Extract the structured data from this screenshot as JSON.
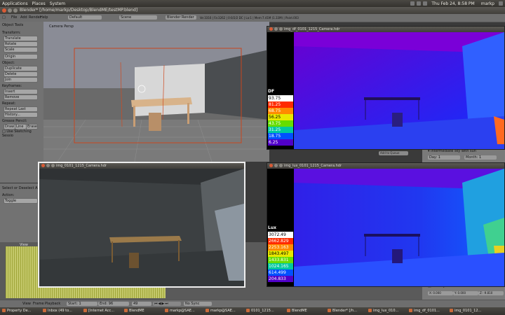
{
  "gnome_panel": {
    "menus": [
      "Applications",
      "Places",
      "System"
    ],
    "datetime": "Thu Feb 24, 8:58 PM",
    "user": "markp"
  },
  "blender_window": {
    "title": "Blender* [/home/markp/Desktop/BlendME/testMP.blend]",
    "menus": [
      "File",
      "Add",
      "Render",
      "Help"
    ],
    "layout_field": "Default",
    "scene_field": "Scene",
    "engine_field": "Blender Render",
    "stats": "Ve:3316 | Fa:3262 | 0:0/2/2 DC | La:1 | Mem:7.41M (1.33M) | Point.003"
  },
  "tool_panel": {
    "header": "Object Tools",
    "transform_label": "Transform:",
    "transform_buttons": [
      "Translate",
      "Rotate",
      "Scale"
    ],
    "origin_button": "Origin",
    "object_label": "Object:",
    "object_buttons": [
      "Duplicate",
      "Delete",
      "Join"
    ],
    "keyframes_label": "Keyframes:",
    "keyframe_buttons": [
      "Insert",
      "Remove"
    ],
    "repeat_label": "Repeat:",
    "repeat_buttons": [
      "Repeat Last",
      "History..."
    ],
    "grease_label": "Grease Pencil:",
    "grease_buttons": [
      "Draw",
      "Line",
      "Erase"
    ],
    "sketching_checkbox": "Use Sketching Sessio",
    "select_deselect": "Select or Deselect All",
    "action_label": "Action:",
    "action_value": "Toggle"
  },
  "viewport": {
    "label": "Camera Persp"
  },
  "timeline": {
    "menus": [
      "View",
      "Frame",
      "Playback"
    ],
    "start": "Start: 1",
    "end": "End: 96",
    "current": "49",
    "sync": "No Sync",
    "view_menu": "View"
  },
  "right_props": {
    "sky_label": "Intermediate sky with sun",
    "day": "Day: 1",
    "month": "Month: 1",
    "add_label": "Add to Queue",
    "gravity": "Gravity",
    "x": "X: 0.000",
    "y": "Y: 0.000",
    "z": "Z: -9.810"
  },
  "windows": {
    "df": {
      "title": "img_df_0101_1215_Camera.hdr",
      "legend_title": "DF",
      "legend": [
        "93.75",
        "81.25",
        "68.75",
        "56.25",
        "43.75",
        "31.25",
        "18.75",
        "6.25"
      ],
      "legend_colors": [
        "#ffffff",
        "#ff2a00",
        "#ff8a00",
        "#e8e800",
        "#66dd00",
        "#00c8a0",
        "#0050ff",
        "#5000c8"
      ]
    },
    "render": {
      "title": "img_0101_1215_Camera.hdr"
    },
    "lux": {
      "title": "img_lux_0101_1215_Camera.hdr",
      "legend_title": "Lux",
      "legend": [
        "3072.49",
        "2662.829",
        "2253.163",
        "1843.497",
        "1433.831",
        "1024.165",
        "614.499",
        "204.833"
      ],
      "legend_colors": [
        "#ffffff",
        "#ff2a00",
        "#ff8a00",
        "#e8e800",
        "#66dd00",
        "#00c8a0",
        "#0050ff",
        "#5000c8"
      ]
    }
  },
  "taskbar": [
    "Property De...",
    "Inbox (49 to...",
    "[Internet Acc...",
    "BlendME",
    "markp@SAE...",
    "markp@SAE...",
    "0101_1215...",
    "BlendME",
    "Blender* [/h...",
    "img_lux_010...",
    "img_df_0101...",
    "img_0101_12..."
  ]
}
